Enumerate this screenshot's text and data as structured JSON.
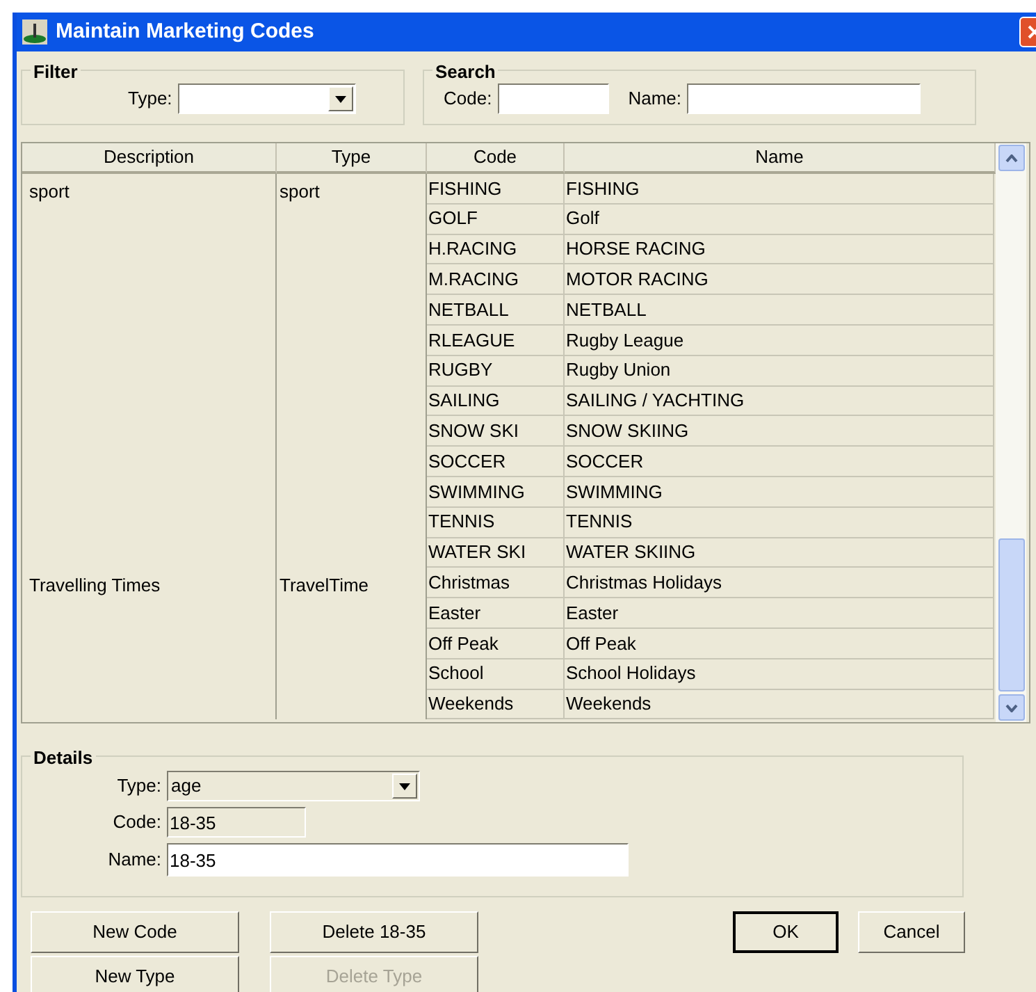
{
  "window": {
    "title": "Maintain Marketing Codes"
  },
  "filter": {
    "title": "Filter",
    "type_label": "Type:"
  },
  "search": {
    "title": "Search",
    "code_label": "Code:",
    "name_label": "Name:"
  },
  "table": {
    "columns": [
      "Description",
      "Type",
      "Code",
      "Name"
    ],
    "groups": [
      {
        "description": "sport",
        "type": "sport",
        "rows": [
          {
            "code": "FISHING",
            "name": "FISHING"
          },
          {
            "code": "GOLF",
            "name": "Golf"
          },
          {
            "code": "H.RACING",
            "name": "HORSE RACING"
          },
          {
            "code": "M.RACING",
            "name": "MOTOR RACING"
          },
          {
            "code": "NETBALL",
            "name": "NETBALL"
          },
          {
            "code": "RLEAGUE",
            "name": "Rugby League"
          },
          {
            "code": "RUGBY",
            "name": "Rugby Union"
          },
          {
            "code": "SAILING",
            "name": "SAILING / YACHTING"
          },
          {
            "code": "SNOW SKI",
            "name": "SNOW SKIING"
          },
          {
            "code": "SOCCER",
            "name": "SOCCER"
          },
          {
            "code": "SWIMMING",
            "name": "SWIMMING"
          },
          {
            "code": "TENNIS",
            "name": "TENNIS"
          },
          {
            "code": "WATER SKI",
            "name": "WATER SKIING"
          }
        ]
      },
      {
        "description": "Travelling Times",
        "type": "TravelTime",
        "rows": [
          {
            "code": "Christmas",
            "name": "Christmas Holidays"
          },
          {
            "code": "Easter",
            "name": "Easter"
          },
          {
            "code": "Off Peak",
            "name": "Off Peak"
          },
          {
            "code": "School",
            "name": "School Holidays"
          },
          {
            "code": "Weekends",
            "name": "Weekends"
          }
        ]
      }
    ]
  },
  "details": {
    "title": "Details",
    "type_label": "Type:",
    "type_value": "age",
    "code_label": "Code:",
    "code_value": "18-35",
    "name_label": "Name:",
    "name_value": "18-35"
  },
  "buttons": [
    {
      "label": "New Code",
      "disabled": false,
      "default": false
    },
    {
      "label": "Delete 18-35",
      "disabled": false,
      "default": false
    },
    {
      "label": "OK",
      "disabled": false,
      "default": true
    },
    {
      "label": "Cancel",
      "disabled": false,
      "default": false
    },
    {
      "label": "New Type",
      "disabled": false,
      "default": false
    },
    {
      "label": "Delete Type",
      "disabled": true,
      "default": false
    }
  ]
}
